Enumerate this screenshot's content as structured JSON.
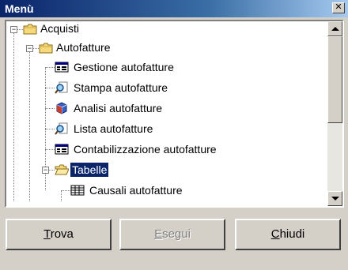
{
  "window": {
    "title": "Menù"
  },
  "tree": {
    "nodes": [
      {
        "label": "Acquisti",
        "icon": "folder-closed-icon",
        "expander": "−"
      },
      {
        "label": "Autofatture",
        "icon": "folder-closed-icon",
        "expander": "−"
      },
      {
        "label": "Gestione autofatture",
        "icon": "form-icon"
      },
      {
        "label": "Stampa autofatture",
        "icon": "magnifier-print-icon"
      },
      {
        "label": "Analisi autofatture",
        "icon": "analysis-cube-icon"
      },
      {
        "label": "Lista autofatture",
        "icon": "magnifier-print-icon"
      },
      {
        "label": "Contabilizzazione autofatture",
        "icon": "form-icon"
      },
      {
        "label": "Tabelle",
        "icon": "folder-open-icon",
        "expander": "−",
        "selected": true
      },
      {
        "label": "Causali autofatture",
        "icon": "table-icon"
      }
    ]
  },
  "buttons": {
    "find": {
      "accel": "T",
      "rest": "rova",
      "enabled": true
    },
    "run": {
      "accel": "E",
      "rest": "segui",
      "enabled": false
    },
    "close": {
      "accel": "C",
      "rest": "hiudi",
      "enabled": true
    }
  },
  "colors": {
    "title_bar": "#0a246a",
    "selection": "#0a246a",
    "face": "#d4d0c8"
  }
}
